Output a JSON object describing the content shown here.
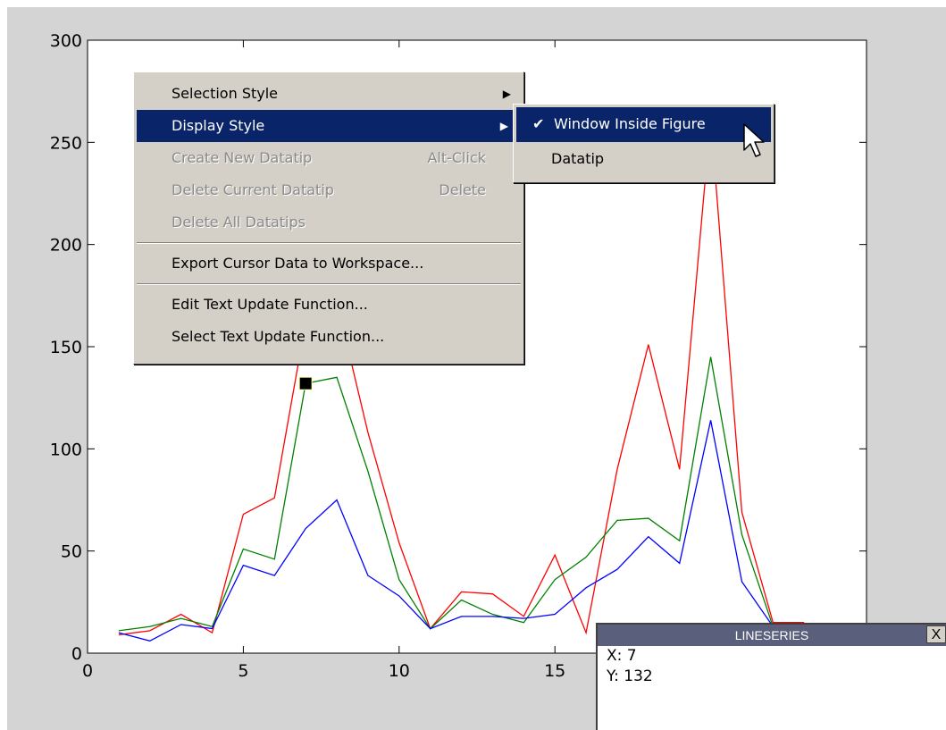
{
  "chart_data": {
    "type": "line",
    "title": "",
    "xlabel": "",
    "ylabel": "",
    "xlim": [
      0,
      25
    ],
    "ylim": [
      0,
      300
    ],
    "x_ticks": [
      0,
      5,
      10,
      15
    ],
    "y_ticks": [
      0,
      50,
      100,
      150,
      200,
      250,
      300
    ],
    "x": [
      1,
      2,
      3,
      4,
      5,
      6,
      7,
      8,
      9,
      10,
      11,
      12,
      13,
      14,
      15,
      16,
      17,
      18,
      19,
      20,
      21,
      22,
      23
    ],
    "series": [
      {
        "color": "#ff0000",
        "values": [
          9,
          11,
          19,
          10,
          68,
          76,
          162,
          172,
          108,
          54,
          12,
          30,
          29,
          18,
          48,
          10,
          90,
          151,
          90,
          262,
          69,
          15,
          15
        ]
      },
      {
        "color": "#008000",
        "values": [
          11,
          13,
          17,
          13,
          51,
          46,
          132,
          135,
          89,
          36,
          12,
          26,
          19,
          15,
          36,
          47,
          65,
          66,
          55,
          145,
          58,
          13,
          13
        ]
      },
      {
        "color": "#0000ff",
        "values": [
          10,
          6,
          14,
          12,
          43,
          38,
          61,
          75,
          38,
          28,
          12,
          18,
          18,
          17,
          19,
          32,
          41,
          57,
          44,
          114,
          35,
          13,
          13
        ]
      }
    ],
    "marker": {
      "x": 7,
      "y": 132,
      "color": "#000000"
    },
    "grid": false
  },
  "context_menu": {
    "items": [
      {
        "label": "Selection Style",
        "state": "normal",
        "submenu": true
      },
      {
        "label": "Display Style",
        "state": "active",
        "submenu": true
      },
      {
        "label": "Create New Datatip",
        "shortcut": "Alt-Click",
        "state": "disabled"
      },
      {
        "label": "Delete Current Datatip",
        "shortcut": "Delete",
        "state": "disabled"
      },
      {
        "label": "Delete All Datatips",
        "state": "disabled"
      },
      {
        "label": "Export Cursor Data to Workspace...",
        "state": "normal"
      },
      {
        "label": "Edit Text Update Function...",
        "state": "normal"
      },
      {
        "label": "Select Text Update Function...",
        "state": "normal"
      }
    ]
  },
  "submenu": {
    "items": [
      {
        "label": "Window Inside Figure",
        "checked": true,
        "state": "active"
      },
      {
        "label": "Datatip",
        "checked": false,
        "state": "normal"
      }
    ]
  },
  "cursor_window": {
    "title": "LINESERIES",
    "close_label": "X",
    "x_text": "X: 7",
    "y_text": "Y: 132"
  }
}
